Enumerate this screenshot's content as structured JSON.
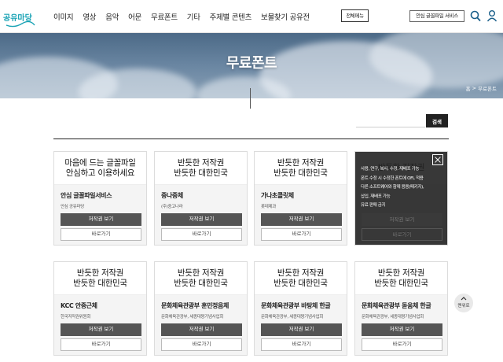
{
  "header": {
    "logo_text": "공유마당",
    "nav": [
      "이미지",
      "영상",
      "음악",
      "어문",
      "무료폰트",
      "기타",
      "주제별 콘텐츠",
      "보물찾기 공유전"
    ],
    "all_menu": "전체메뉴",
    "service_button": "안심 글꼴파일 서비스"
  },
  "hero": {
    "title": "무료폰트",
    "breadcrumb_home": "홈",
    "breadcrumb_sep": ">",
    "breadcrumb_current": "무료폰트"
  },
  "search": {
    "placeholder": "",
    "button": "검색"
  },
  "colors": {
    "accent": "#1aa3b5",
    "dark_button": "#555555"
  },
  "cards": [
    {
      "lines": [
        "마음에 드는 글꼴파일",
        "안심하고 이용하세요"
      ],
      "name": "안심 글꼴파일서비스",
      "maker": "안심 공유마당",
      "copyright": "저작권 보기",
      "go": "바로가기"
    },
    {
      "lines": [
        "반듯한 저작권",
        "반듯한 대한민국"
      ],
      "name": "중나중체",
      "maker": "(주)중고나라",
      "copyright": "저작권 보기",
      "go": "바로가기"
    },
    {
      "lines": [
        "반듯한 저작권",
        "반듯한 대한민국"
      ],
      "name": "가나초콜릿체",
      "maker": "롯데제과",
      "copyright": "저작권 보기",
      "go": "바로가기"
    },
    {
      "lines": [
        "반듯한 저작권",
        ""
      ],
      "name": "",
      "maker": "",
      "copyright": "저작권 보기",
      "go": "바로가기",
      "overlay": [
        "사용, 연구, 복사, 수정, 재배포 가능",
        "폰트 수정 시 수정한 폰트에 OFL 적용",
        "다른 소프트웨어와 함께 용용(패키지),",
        "삽입, 재배포 가능",
        "유료 판매 금지"
      ]
    },
    {
      "lines": [
        "반듯한 저작권",
        "반듯한 대한민국"
      ],
      "name": "KCC 안중근체",
      "maker": "한국저작권위원회",
      "copyright": "저작권 보기",
      "go": "바로가기"
    },
    {
      "lines": [
        "반듯한 저작권",
        "반듯한 대한민국"
      ],
      "name": "문화체육관광부 훈민정음체",
      "maker": "문화체육관광부, 세종대왕기념사업회",
      "copyright": "저작권 보기",
      "go": "바로가기"
    },
    {
      "lines": [
        "반듯한 저작권",
        "반듯한 대한민국"
      ],
      "name": "문화체육관광부 바탕체 한글",
      "maker": "문화체육관광부, 세종대왕기념사업회",
      "copyright": "저작권 보기",
      "go": "바로가기"
    },
    {
      "lines": [
        "반듯한 저작권",
        "반듯한 대한민국"
      ],
      "name": "문화체육관광부 돋움체 한글",
      "maker": "문화체육관광부, 세종대왕기념사업회",
      "copyright": "저작권 보기",
      "go": "바로가기"
    }
  ],
  "top_button": {
    "label": "맨위로"
  }
}
